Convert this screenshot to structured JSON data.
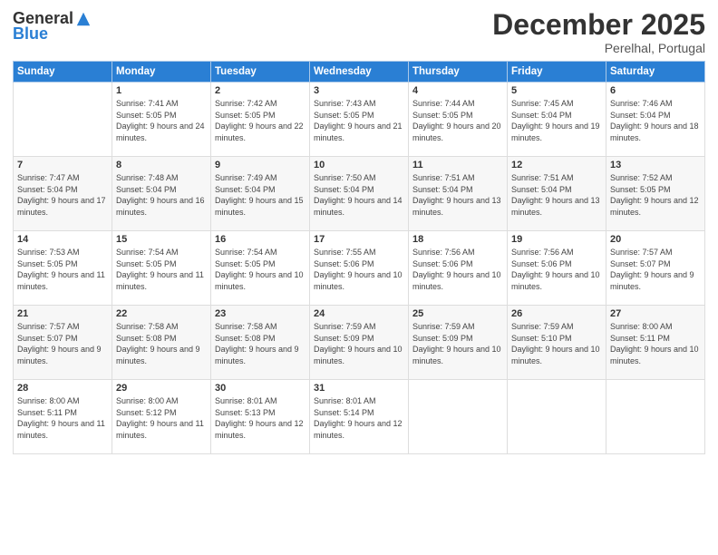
{
  "logo": {
    "general": "General",
    "blue": "Blue"
  },
  "title": "December 2025",
  "subtitle": "Perelhal, Portugal",
  "days_header": [
    "Sunday",
    "Monday",
    "Tuesday",
    "Wednesday",
    "Thursday",
    "Friday",
    "Saturday"
  ],
  "weeks": [
    [
      {
        "day": "",
        "sunrise": "",
        "sunset": "",
        "daylight": ""
      },
      {
        "day": "1",
        "sunrise": "Sunrise: 7:41 AM",
        "sunset": "Sunset: 5:05 PM",
        "daylight": "Daylight: 9 hours and 24 minutes."
      },
      {
        "day": "2",
        "sunrise": "Sunrise: 7:42 AM",
        "sunset": "Sunset: 5:05 PM",
        "daylight": "Daylight: 9 hours and 22 minutes."
      },
      {
        "day": "3",
        "sunrise": "Sunrise: 7:43 AM",
        "sunset": "Sunset: 5:05 PM",
        "daylight": "Daylight: 9 hours and 21 minutes."
      },
      {
        "day": "4",
        "sunrise": "Sunrise: 7:44 AM",
        "sunset": "Sunset: 5:05 PM",
        "daylight": "Daylight: 9 hours and 20 minutes."
      },
      {
        "day": "5",
        "sunrise": "Sunrise: 7:45 AM",
        "sunset": "Sunset: 5:04 PM",
        "daylight": "Daylight: 9 hours and 19 minutes."
      },
      {
        "day": "6",
        "sunrise": "Sunrise: 7:46 AM",
        "sunset": "Sunset: 5:04 PM",
        "daylight": "Daylight: 9 hours and 18 minutes."
      }
    ],
    [
      {
        "day": "7",
        "sunrise": "Sunrise: 7:47 AM",
        "sunset": "Sunset: 5:04 PM",
        "daylight": "Daylight: 9 hours and 17 minutes."
      },
      {
        "day": "8",
        "sunrise": "Sunrise: 7:48 AM",
        "sunset": "Sunset: 5:04 PM",
        "daylight": "Daylight: 9 hours and 16 minutes."
      },
      {
        "day": "9",
        "sunrise": "Sunrise: 7:49 AM",
        "sunset": "Sunset: 5:04 PM",
        "daylight": "Daylight: 9 hours and 15 minutes."
      },
      {
        "day": "10",
        "sunrise": "Sunrise: 7:50 AM",
        "sunset": "Sunset: 5:04 PM",
        "daylight": "Daylight: 9 hours and 14 minutes."
      },
      {
        "day": "11",
        "sunrise": "Sunrise: 7:51 AM",
        "sunset": "Sunset: 5:04 PM",
        "daylight": "Daylight: 9 hours and 13 minutes."
      },
      {
        "day": "12",
        "sunrise": "Sunrise: 7:51 AM",
        "sunset": "Sunset: 5:04 PM",
        "daylight": "Daylight: 9 hours and 13 minutes."
      },
      {
        "day": "13",
        "sunrise": "Sunrise: 7:52 AM",
        "sunset": "Sunset: 5:05 PM",
        "daylight": "Daylight: 9 hours and 12 minutes."
      }
    ],
    [
      {
        "day": "14",
        "sunrise": "Sunrise: 7:53 AM",
        "sunset": "Sunset: 5:05 PM",
        "daylight": "Daylight: 9 hours and 11 minutes."
      },
      {
        "day": "15",
        "sunrise": "Sunrise: 7:54 AM",
        "sunset": "Sunset: 5:05 PM",
        "daylight": "Daylight: 9 hours and 11 minutes."
      },
      {
        "day": "16",
        "sunrise": "Sunrise: 7:54 AM",
        "sunset": "Sunset: 5:05 PM",
        "daylight": "Daylight: 9 hours and 10 minutes."
      },
      {
        "day": "17",
        "sunrise": "Sunrise: 7:55 AM",
        "sunset": "Sunset: 5:06 PM",
        "daylight": "Daylight: 9 hours and 10 minutes."
      },
      {
        "day": "18",
        "sunrise": "Sunrise: 7:56 AM",
        "sunset": "Sunset: 5:06 PM",
        "daylight": "Daylight: 9 hours and 10 minutes."
      },
      {
        "day": "19",
        "sunrise": "Sunrise: 7:56 AM",
        "sunset": "Sunset: 5:06 PM",
        "daylight": "Daylight: 9 hours and 10 minutes."
      },
      {
        "day": "20",
        "sunrise": "Sunrise: 7:57 AM",
        "sunset": "Sunset: 5:07 PM",
        "daylight": "Daylight: 9 hours and 9 minutes."
      }
    ],
    [
      {
        "day": "21",
        "sunrise": "Sunrise: 7:57 AM",
        "sunset": "Sunset: 5:07 PM",
        "daylight": "Daylight: 9 hours and 9 minutes."
      },
      {
        "day": "22",
        "sunrise": "Sunrise: 7:58 AM",
        "sunset": "Sunset: 5:08 PM",
        "daylight": "Daylight: 9 hours and 9 minutes."
      },
      {
        "day": "23",
        "sunrise": "Sunrise: 7:58 AM",
        "sunset": "Sunset: 5:08 PM",
        "daylight": "Daylight: 9 hours and 9 minutes."
      },
      {
        "day": "24",
        "sunrise": "Sunrise: 7:59 AM",
        "sunset": "Sunset: 5:09 PM",
        "daylight": "Daylight: 9 hours and 10 minutes."
      },
      {
        "day": "25",
        "sunrise": "Sunrise: 7:59 AM",
        "sunset": "Sunset: 5:09 PM",
        "daylight": "Daylight: 9 hours and 10 minutes."
      },
      {
        "day": "26",
        "sunrise": "Sunrise: 7:59 AM",
        "sunset": "Sunset: 5:10 PM",
        "daylight": "Daylight: 9 hours and 10 minutes."
      },
      {
        "day": "27",
        "sunrise": "Sunrise: 8:00 AM",
        "sunset": "Sunset: 5:11 PM",
        "daylight": "Daylight: 9 hours and 10 minutes."
      }
    ],
    [
      {
        "day": "28",
        "sunrise": "Sunrise: 8:00 AM",
        "sunset": "Sunset: 5:11 PM",
        "daylight": "Daylight: 9 hours and 11 minutes."
      },
      {
        "day": "29",
        "sunrise": "Sunrise: 8:00 AM",
        "sunset": "Sunset: 5:12 PM",
        "daylight": "Daylight: 9 hours and 11 minutes."
      },
      {
        "day": "30",
        "sunrise": "Sunrise: 8:01 AM",
        "sunset": "Sunset: 5:13 PM",
        "daylight": "Daylight: 9 hours and 12 minutes."
      },
      {
        "day": "31",
        "sunrise": "Sunrise: 8:01 AM",
        "sunset": "Sunset: 5:14 PM",
        "daylight": "Daylight: 9 hours and 12 minutes."
      },
      {
        "day": "",
        "sunrise": "",
        "sunset": "",
        "daylight": ""
      },
      {
        "day": "",
        "sunrise": "",
        "sunset": "",
        "daylight": ""
      },
      {
        "day": "",
        "sunrise": "",
        "sunset": "",
        "daylight": ""
      }
    ]
  ]
}
